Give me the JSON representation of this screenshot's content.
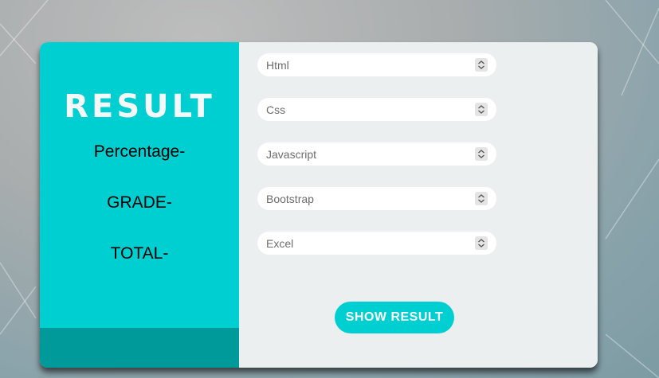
{
  "colors": {
    "accent": "#00cfd1",
    "accent_dark": "#019a9b",
    "panel": "#ebeff0"
  },
  "result_panel": {
    "title": "RESULT",
    "percentage_label": "Percentage-",
    "grade_label": "GRADE-",
    "total_label": "TOTAL-"
  },
  "inputs": [
    {
      "placeholder": "Html",
      "value": ""
    },
    {
      "placeholder": "Css",
      "value": ""
    },
    {
      "placeholder": "Javascript",
      "value": ""
    },
    {
      "placeholder": "Bootstrap",
      "value": ""
    },
    {
      "placeholder": "Excel",
      "value": ""
    }
  ],
  "show_button": {
    "label": "SHOW RESULT"
  }
}
